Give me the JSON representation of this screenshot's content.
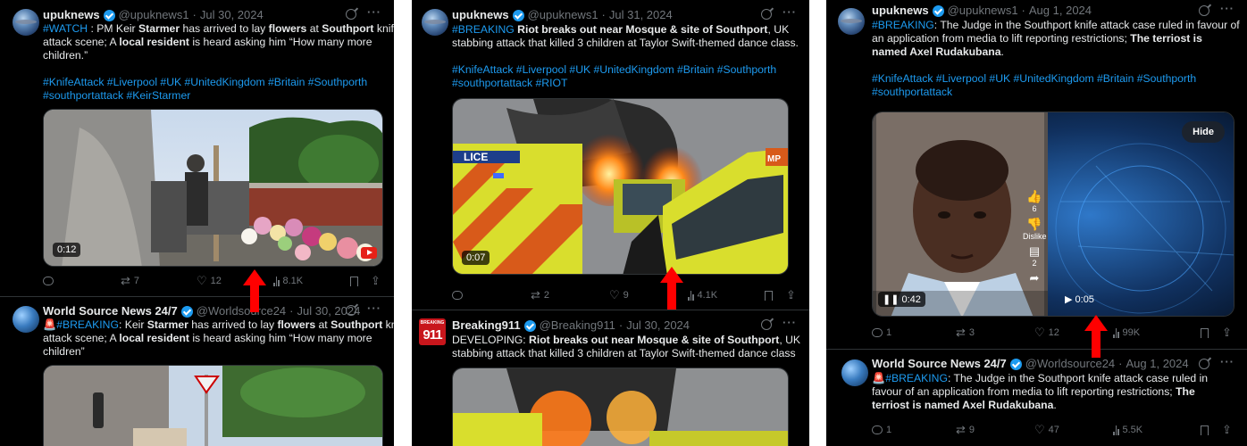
{
  "panels": [
    {
      "tweets": [
        {
          "name": "upuknews",
          "handle": "@upuknews1",
          "date": "Jul 30, 2024",
          "text_lines": [
            [
              {
                "t": "#WATCH",
                "c": "tag"
              },
              {
                "t": " : PM Keir "
              },
              {
                "t": "Starmer",
                "c": "b"
              },
              {
                "t": " has arrived to lay "
              },
              {
                "t": "flowers",
                "c": "b"
              },
              {
                "t": " at "
              },
              {
                "t": "Southport",
                "c": "b"
              },
              {
                "t": " knife"
              }
            ],
            [
              {
                "t": "attack scene; A "
              },
              {
                "t": "local resident",
                "c": "b"
              },
              {
                "t": " is heard asking him “How many more"
              }
            ],
            [
              {
                "t": "children.”"
              }
            ],
            [
              {
                "t": ""
              }
            ],
            [
              {
                "t": "#KnifeAttack #Liverpool #UK #UnitedKingdom #Britain #Southporth",
                "c": "tag"
              }
            ],
            [
              {
                "t": "#southportattack #KeirStarmer",
                "c": "tag"
              }
            ]
          ],
          "video_duration": "0:12",
          "replies": "",
          "reposts": "7",
          "likes": "12",
          "views": "8.1K"
        },
        {
          "name": "World Source News 24/7",
          "handle": "@Worldsource24",
          "date": "Jul 30, 2024",
          "text_lines": [
            [
              {
                "t": "🚨"
              },
              {
                "t": "#BREAKING",
                "c": "tag"
              },
              {
                "t": ": Keir "
              },
              {
                "t": "Starmer",
                "c": "b"
              },
              {
                "t": " has arrived to lay "
              },
              {
                "t": "flowers",
                "c": "b"
              },
              {
                "t": " at "
              },
              {
                "t": "Southport",
                "c": "b"
              },
              {
                "t": " knife"
              }
            ],
            [
              {
                "t": "attack scene; A "
              },
              {
                "t": "local resident",
                "c": "b"
              },
              {
                "t": " is heard asking him “How many more"
              }
            ],
            [
              {
                "t": "children”"
              }
            ]
          ]
        }
      ]
    },
    {
      "tweets": [
        {
          "name": "upuknews",
          "handle": "@upuknews1",
          "date": "Jul 31, 2024",
          "text_lines": [
            [
              {
                "t": "#BREAKING",
                "c": "tag"
              },
              {
                "t": " "
              },
              {
                "t": "Riot breaks out near Mosque & site of Southport",
                "c": "b"
              },
              {
                "t": ", UK"
              }
            ],
            [
              {
                "t": "stabbing attack that killed 3 children at Taylor Swift-themed dance class."
              }
            ],
            [
              {
                "t": ""
              }
            ],
            [
              {
                "t": "#KnifeAttack #Liverpool #UK #UnitedKingdom #Britain #Southporth",
                "c": "tag"
              }
            ],
            [
              {
                "t": "#southportattack #RIOT",
                "c": "tag"
              }
            ]
          ],
          "video_duration": "0:07",
          "replies": "",
          "reposts": "2",
          "likes": "9",
          "views": "4.1K"
        },
        {
          "name": "Breaking911",
          "handle": "@Breaking911",
          "date": "Jul 30, 2024",
          "avatar_text": "911",
          "avatar_top": "BREAKING",
          "text_lines": [
            [
              {
                "t": "DEVELOPING: "
              },
              {
                "t": "Riot breaks out near Mosque & site of Southport",
                "c": "b"
              },
              {
                "t": ", UK"
              }
            ],
            [
              {
                "t": "stabbing attack that killed 3 children at Taylor Swift-themed dance class"
              }
            ]
          ]
        }
      ]
    },
    {
      "tweets": [
        {
          "name": "upuknews",
          "handle": "@upuknews1",
          "date": "Aug 1, 2024",
          "text_lines": [
            [
              {
                "t": "#BREAKING",
                "c": "tag"
              },
              {
                "t": ": The Judge in the Southport knife attack case ruled in favour of"
              }
            ],
            [
              {
                "t": "an application from media to lift reporting restrictions; "
              },
              {
                "t": "The terriost is",
                "c": "b"
              }
            ],
            [
              {
                "t": "named Axel Rudakubana",
                "c": "b"
              },
              {
                "t": "."
              }
            ],
            [
              {
                "t": ""
              }
            ],
            [
              {
                "t": "#KnifeAttack #Liverpool #UK #UnitedKingdom #Britain #Southporth",
                "c": "tag"
              }
            ],
            [
              {
                "t": "#southportattack",
                "c": "tag"
              }
            ]
          ],
          "video_duration": "0:42",
          "video2_duration": "0:05",
          "like_count_overlay": "6",
          "dislike_label": "Dislike",
          "comment_count_overlay": "2",
          "hide_label": "Hide",
          "replies": "1",
          "reposts": "3",
          "likes": "12",
          "views": "99K"
        },
        {
          "name": "World Source News 24/7",
          "handle": "@Worldsource24",
          "date": "Aug 1, 2024",
          "text_lines": [
            [
              {
                "t": "🚨"
              },
              {
                "t": "#BREAKING",
                "c": "tag"
              },
              {
                "t": ": The Judge in the Southport knife attack case ruled in"
              }
            ],
            [
              {
                "t": "favour of an application from media to lift reporting restrictions; "
              },
              {
                "t": "The",
                "c": "b"
              }
            ],
            [
              {
                "t": "terriost is named Axel Rudakubana",
                "c": "b"
              },
              {
                "t": "."
              }
            ]
          ],
          "replies": "1",
          "reposts": "9",
          "likes": "47",
          "views": "5.5K"
        }
      ]
    }
  ],
  "colors": {
    "background": "#000000",
    "text": "#e7e9ea",
    "muted": "#71767b",
    "link": "#1d9bf0",
    "arrow": "#ff0000"
  }
}
